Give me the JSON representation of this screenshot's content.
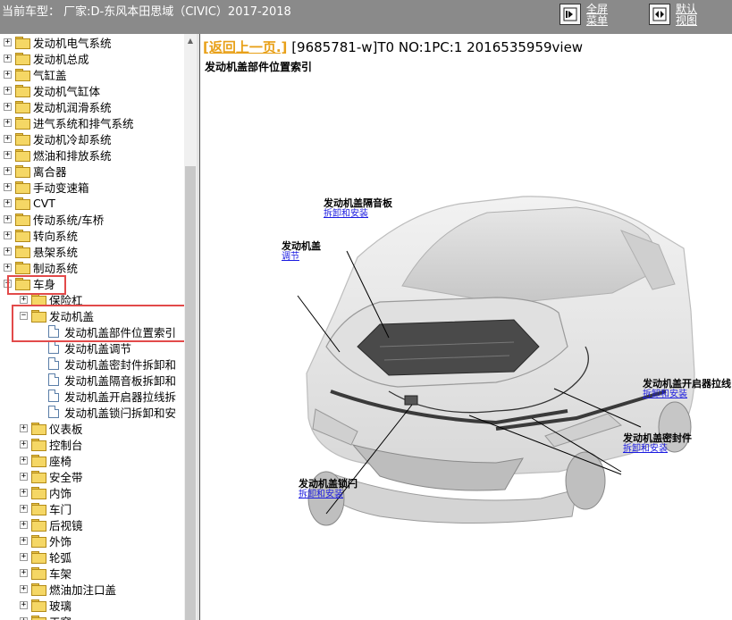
{
  "header": {
    "vehicle": "当前车型： 厂家:D-东风本田思域（CIVIC）2017-2018",
    "fullscreen_label": "全屏菜单",
    "default_label": "默认视图"
  },
  "tree": {
    "items": [
      {
        "label": "发动机电气系统",
        "expander": "+"
      },
      {
        "label": "发动机总成",
        "expander": "+"
      },
      {
        "label": "气缸盖",
        "expander": "+"
      },
      {
        "label": "发动机气缸体",
        "expander": "+"
      },
      {
        "label": "发动机润滑系统",
        "expander": "+"
      },
      {
        "label": "进气系统和排气系统",
        "expander": "+"
      },
      {
        "label": "发动机冷却系统",
        "expander": "+"
      },
      {
        "label": "燃油和排放系统",
        "expander": "+"
      },
      {
        "label": "离合器",
        "expander": "+"
      },
      {
        "label": "手动变速箱",
        "expander": "+"
      },
      {
        "label": "CVT",
        "expander": "+"
      },
      {
        "label": "传动系统/车桥",
        "expander": "+"
      },
      {
        "label": "转向系统",
        "expander": "+"
      },
      {
        "label": "悬架系统",
        "expander": "+"
      },
      {
        "label": "制动系统",
        "expander": "+"
      },
      {
        "label": "车身",
        "expander": "−"
      },
      {
        "label": "保险杠",
        "expander": "+"
      },
      {
        "label": "发动机盖",
        "expander": "−"
      },
      {
        "label": "发动机盖部件位置索引"
      },
      {
        "label": "发动机盖调节"
      },
      {
        "label": "发动机盖密封件拆卸和"
      },
      {
        "label": "发动机盖隔音板拆卸和"
      },
      {
        "label": "发动机盖开启器拉线拆"
      },
      {
        "label": "发动机盖锁闩拆卸和安"
      },
      {
        "label": "仪表板",
        "expander": "+"
      },
      {
        "label": "控制台",
        "expander": "+"
      },
      {
        "label": "座椅",
        "expander": "+"
      },
      {
        "label": "安全带",
        "expander": "+"
      },
      {
        "label": "内饰",
        "expander": "+"
      },
      {
        "label": "车门",
        "expander": "+"
      },
      {
        "label": "后视镜",
        "expander": "+"
      },
      {
        "label": "外饰",
        "expander": "+"
      },
      {
        "label": "轮弧",
        "expander": "+"
      },
      {
        "label": "车架",
        "expander": "+"
      },
      {
        "label": "燃油加注口盖",
        "expander": "+"
      },
      {
        "label": "玻璃",
        "expander": "+"
      },
      {
        "label": "天窗",
        "expander": "+"
      }
    ]
  },
  "content": {
    "back_link": "[返回上一页.]",
    "doc_code": " [9685781-w]T0 NO:1PC:1 2016535959view",
    "title": "发动机盖部件位置索引"
  },
  "callouts": {
    "insulator": {
      "name": "发动机盖隔音板",
      "link": "拆卸和安装"
    },
    "hood": {
      "name": "发动机盖",
      "link": "调节"
    },
    "cable": {
      "name": "发动机盖开启器拉线",
      "link": "拆卸和安装"
    },
    "seal": {
      "name": "发动机盖密封件",
      "link": "拆卸和安装"
    },
    "latch": {
      "name": "发动机盖锁闩",
      "link": "拆卸和安装"
    }
  }
}
